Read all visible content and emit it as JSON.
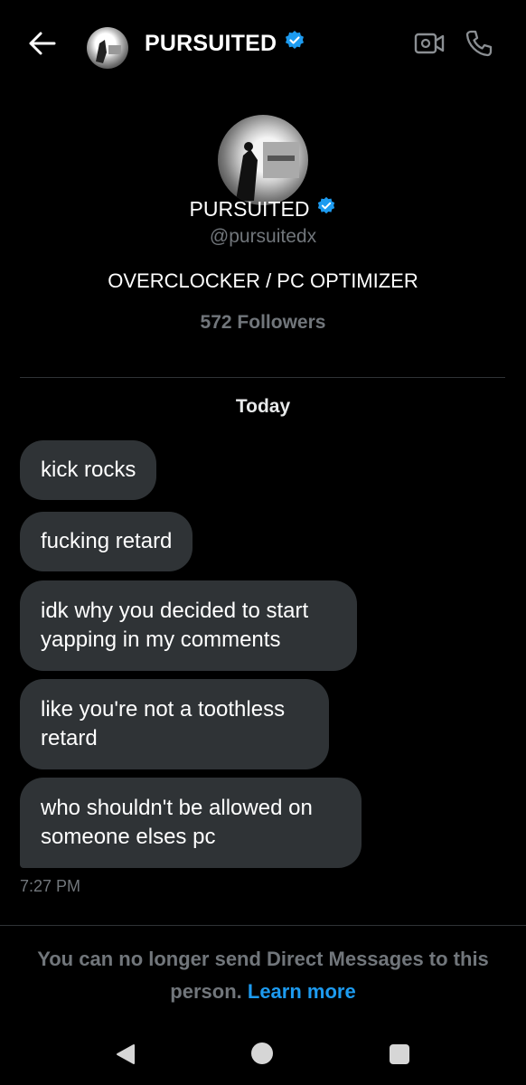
{
  "header": {
    "title": "PURSUITED",
    "back_icon": "arrow-left-icon",
    "video_icon": "video-call-icon",
    "call_icon": "phone-icon"
  },
  "profile": {
    "name": "PURSUITED",
    "handle": "@pursuitedx",
    "bio": "OVERCLOCKER / PC OPTIMIZER",
    "followers": "572 Followers",
    "verified_color": "#1d9bf0"
  },
  "conversation": {
    "date_separator": "Today",
    "messages": [
      "kick rocks",
      "fucking retard",
      "idk why you decided to start yapping in my comments",
      "like you're not a toothless retard",
      "who shouldn't be allowed on someone elses pc"
    ],
    "timestamp": "7:27 PM"
  },
  "notice": {
    "text": "You can no longer send Direct Messages to this person.",
    "link": "Learn more"
  },
  "colors": {
    "background": "#000000",
    "bubble": "#2f3336",
    "muted": "#71767b",
    "accent": "#1d9bf0"
  }
}
